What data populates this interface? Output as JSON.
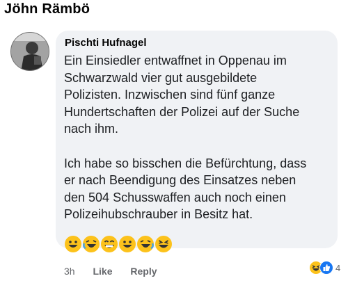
{
  "header": {
    "title": "Jöhn Rämbö"
  },
  "comment": {
    "author": "Pischti Hufnagel",
    "text": "Ein Einsiedler entwaffnet in Oppenau im\nSchwarzwald vier gut ausgebildete\nPolizisten. Inzwischen sind fünf ganze\nHundertschaften der Polizei auf der Suche\nnach ihm.\n\nIch habe so bisschen die Befürchtung, dass\ner nach Beendigung des Einsatzes neben\nden 504 Schusswaffen auch noch einen\nPolizeihubschrauber in Besitz hat.",
    "emojis": [
      "grinning-face-icon",
      "rolling-laughing-face-icon",
      "beaming-face-icon",
      "grinning-face-icon",
      "rolling-laughing-face-icon",
      "squinting-laughing-face-icon"
    ]
  },
  "actions": {
    "time": "3h",
    "like": "Like",
    "reply": "Reply"
  },
  "reactions": {
    "icons": [
      "haha-reaction-icon",
      "like-reaction-icon"
    ],
    "count": "4"
  },
  "colors": {
    "bubble": "#f0f2f5",
    "meta": "#65676b",
    "emoji": "#fcc21b",
    "like": "#1877f2"
  }
}
